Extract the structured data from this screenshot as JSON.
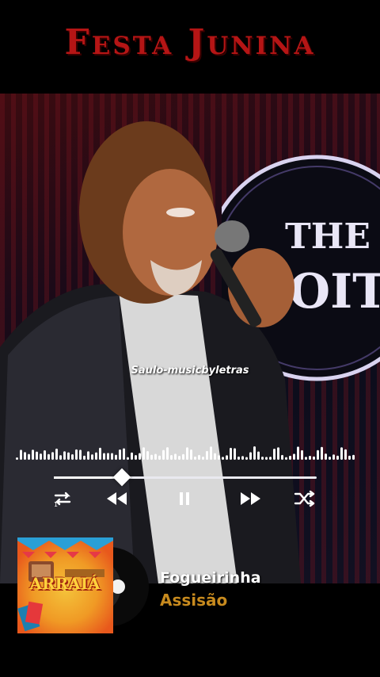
{
  "header": {
    "title": "Festa Junina"
  },
  "video": {
    "caption": "Saulo-musicbyletras"
  },
  "player": {
    "progress_fraction": 0.26,
    "controls": [
      {
        "name": "repeat-one-icon"
      },
      {
        "name": "rewind-icon"
      },
      {
        "name": "pause-icon"
      },
      {
        "name": "fast-forward-icon"
      },
      {
        "name": "shuffle-icon"
      }
    ]
  },
  "now_playing": {
    "song_title": "Fogueirinha",
    "artist": "Assisão",
    "cover_text": "ARRAIÁ"
  },
  "colors": {
    "title_red": "#b51515",
    "artist_gold": "#c78a1e",
    "waveform": "#ffffff"
  }
}
